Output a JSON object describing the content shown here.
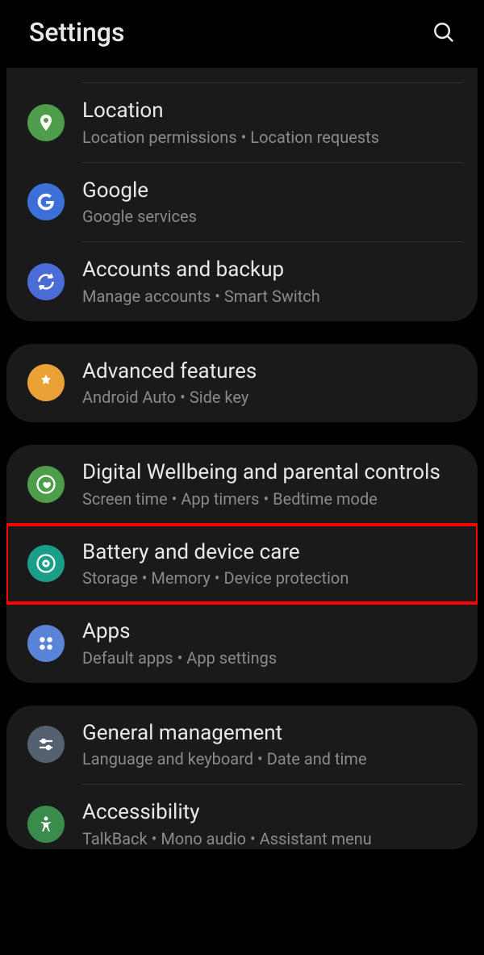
{
  "header": {
    "title": "Settings"
  },
  "groups": [
    {
      "items": [
        {
          "title": "Location",
          "sub": "Location permissions  •  Location requests"
        },
        {
          "title": "Google",
          "sub": "Google services"
        },
        {
          "title": "Accounts and backup",
          "sub": "Manage accounts  •  Smart Switch"
        }
      ]
    },
    {
      "items": [
        {
          "title": "Advanced features",
          "sub": "Android Auto  •  Side key"
        }
      ]
    },
    {
      "items": [
        {
          "title": "Digital Wellbeing and parental controls",
          "sub": "Screen time  •  App timers  •  Bedtime mode"
        },
        {
          "title": "Battery and device care",
          "sub": "Storage  •  Memory  •  Device protection"
        },
        {
          "title": "Apps",
          "sub": "Default apps  •  App settings"
        }
      ]
    },
    {
      "items": [
        {
          "title": "General management",
          "sub": "Language and keyboard  •  Date and time"
        },
        {
          "title": "Accessibility",
          "sub": "TalkBack  •  Mono audio  •  Assistant menu"
        }
      ]
    }
  ]
}
